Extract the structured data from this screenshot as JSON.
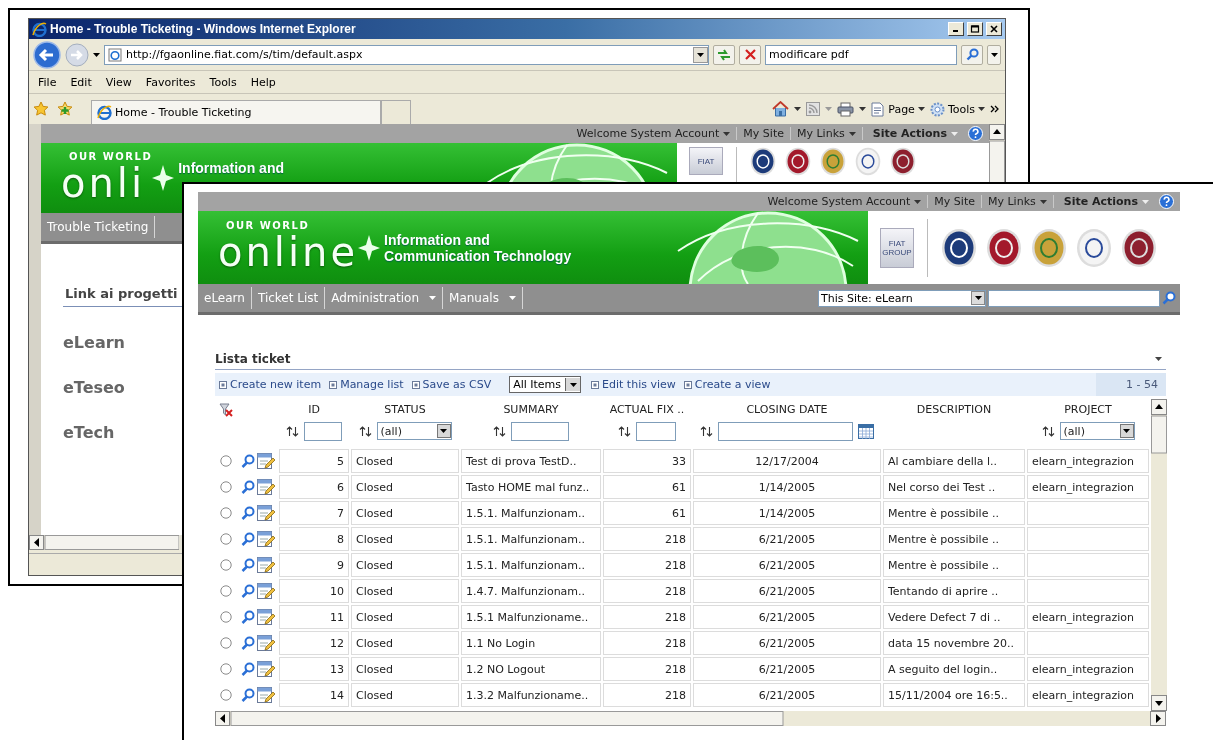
{
  "back_window": {
    "title": "Home - Trouble Ticketing - Windows Internet Explorer",
    "address": "http://fgaonline.fiat.com/s/tim/default.aspx",
    "search_value": "modificare pdf",
    "menu": [
      "File",
      "Edit",
      "View",
      "Favorites",
      "Tools",
      "Help"
    ],
    "tab": "Home - Trouble Ticketing",
    "page_menu": "Page",
    "tools_menu": "Tools",
    "site_bar": {
      "welcome": "Welcome System Account",
      "links": [
        {
          "label": "My Site",
          "menu": false
        },
        {
          "label": "My Links",
          "menu": true
        }
      ],
      "site_actions": "Site Actions"
    },
    "banner": {
      "small": "OUR WORLD",
      "logo": "onli",
      "tagline": [
        "Information and"
      ],
      "brand_box": "FIAT"
    },
    "nav": [
      {
        "label": "Trouble Ticketing",
        "menu": false
      }
    ],
    "links_heading": "Link ai progetti",
    "project_links": [
      "eLearn",
      "eTeseo",
      "eTech"
    ]
  },
  "front_window": {
    "site_bar": {
      "welcome": "Welcome System Account",
      "links": [
        {
          "label": "My Site",
          "menu": false
        },
        {
          "label": "My Links",
          "menu": true
        }
      ],
      "site_actions": "Site Actions"
    },
    "banner": {
      "small": "OUR WORLD",
      "logo": "online",
      "tagline": [
        "Information and",
        "Communication Technology"
      ],
      "brand_box": "FIAT GROUP"
    },
    "nav": [
      {
        "label": "eLearn",
        "menu": false
      },
      {
        "label": "Ticket List",
        "menu": false
      },
      {
        "label": "Administration",
        "menu": true
      },
      {
        "label": "Manuals",
        "menu": true
      }
    ],
    "search_scope": "This Site: eLearn",
    "list_title": "Lista ticket",
    "toolbar": [
      "Create new item",
      "Manage list",
      "Save as CSV"
    ],
    "view": "All Items",
    "view_actions": [
      "Edit this view",
      "Create a view"
    ],
    "paging": "1 - 54",
    "table": {
      "columns": [
        {
          "label": "ID",
          "kind": "text"
        },
        {
          "label": "STATUS",
          "kind": "select",
          "value": "(all)"
        },
        {
          "label": "SUMMARY",
          "kind": "text"
        },
        {
          "label": "ACTUAL FIX ..",
          "kind": "text"
        },
        {
          "label": "CLOSING DATE",
          "kind": "date"
        },
        {
          "label": "DESCRIPTION",
          "kind": "none"
        },
        {
          "label": "PROJECT",
          "kind": "select",
          "value": "(all)"
        }
      ],
      "rows": [
        {
          "selected": false,
          "id": "5",
          "status": "Closed",
          "summary": "Test di prova TestD..",
          "actual_fix": "33",
          "closing_date": "12/17/2004",
          "description": "Al cambiare della l..",
          "project": "elearn_integrazion"
        },
        {
          "selected": false,
          "id": "6",
          "status": "Closed",
          "summary": "Tasto HOME mal funz..",
          "actual_fix": "61",
          "closing_date": "1/14/2005",
          "description": "Nel corso dei Test ..",
          "project": "elearn_integrazion"
        },
        {
          "selected": false,
          "id": "7",
          "status": "Closed",
          "summary": "1.5.1. Malfunzionam..",
          "actual_fix": "61",
          "closing_date": "1/14/2005",
          "description": "Mentre è possibile .."
        },
        {
          "selected": false,
          "id": "8",
          "status": "Closed",
          "summary": "1.5.1. Malfunzionam..",
          "actual_fix": "218",
          "closing_date": "6/21/2005",
          "description": "Mentre è possibile .."
        },
        {
          "selected": false,
          "id": "9",
          "status": "Closed",
          "summary": "1.5.1. Malfunzionam..",
          "actual_fix": "218",
          "closing_date": "6/21/2005",
          "description": "Mentre è possibile .."
        },
        {
          "selected": false,
          "id": "10",
          "status": "Closed",
          "summary": "1.4.7. Malfunzionam..",
          "actual_fix": "218",
          "closing_date": "6/21/2005",
          "description": "Tentando di aprire .."
        },
        {
          "selected": false,
          "id": "11",
          "status": "Closed",
          "summary": "1.5.1 Malfunzioname..",
          "actual_fix": "218",
          "closing_date": "6/21/2005",
          "description": "Vedere Defect 7 di ..",
          "project": "elearn_integrazion"
        },
        {
          "selected": false,
          "id": "12",
          "status": "Closed",
          "summary": "1.1 No Login",
          "actual_fix": "218",
          "closing_date": "6/21/2005",
          "description": "data 15 novembre 20.."
        },
        {
          "selected": false,
          "id": "13",
          "status": "Closed",
          "summary": "1.2 NO Logout",
          "actual_fix": "218",
          "closing_date": "6/21/2005",
          "description": "A seguito del login..",
          "project": "elearn_integrazion"
        },
        {
          "selected": false,
          "id": "14",
          "status": "Closed",
          "summary": "1.3.2 Malfunzioname..",
          "actual_fix": "218",
          "closing_date": "6/21/2005",
          "description": "15/11/2004 ore 16:5..",
          "project": "elearn_integrazion"
        }
      ]
    }
  }
}
